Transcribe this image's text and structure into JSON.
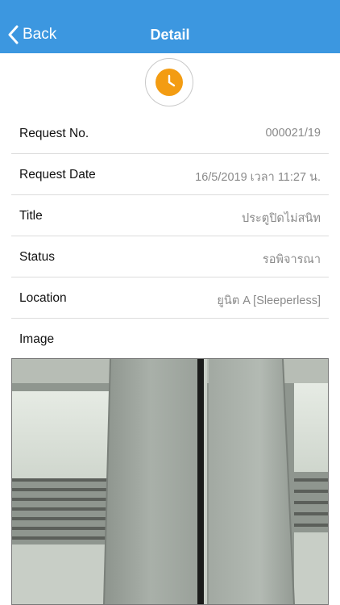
{
  "nav": {
    "back_label": "Back",
    "title": "Detail"
  },
  "status_icon": {
    "icon": "clock-icon",
    "color": "#f39c12"
  },
  "details": [
    {
      "label": "Request No.",
      "value": "000021/19"
    },
    {
      "label": "Request Date",
      "value": "16/5/2019 เวลา 11:27 น."
    },
    {
      "label": "Title",
      "value": "ประตูปิดไม่สนิท"
    },
    {
      "label": "Status",
      "value": "รอพิจารณา"
    },
    {
      "label": "Location",
      "value": "ยูนิต A [Sleeperless]"
    },
    {
      "label": "Image",
      "value": ""
    }
  ],
  "colors": {
    "nav_bar": "#3c97e0",
    "accent": "#f39c12"
  }
}
